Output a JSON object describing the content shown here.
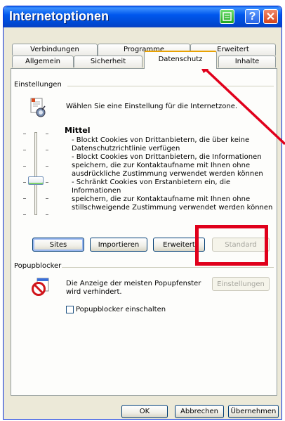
{
  "window": {
    "title": "Internetoptionen"
  },
  "tabs_back": [
    "Verbindungen",
    "Programme",
    "Erweitert"
  ],
  "tabs_front": [
    "Allgemein",
    "Sicherheit",
    "Datenschutz",
    "Inhalte"
  ],
  "active_tab": "Datenschutz",
  "settings": {
    "group_label": "Einstellungen",
    "intro": "Wählen Sie eine Einstellung für die Internetzone.",
    "level_title": "Mittel",
    "description": [
      "- Blockt Cookies von Drittanbietern, die über keine",
      "Datenschutzrichtlinie verfügen",
      "- Blockt Cookies von Drittanbietern, die Informationen",
      "speichern, die zur Kontaktaufname mit Ihnen ohne",
      "ausdrückliche Zustimmung verwendet werden können",
      "- Schränkt Cookies von Erstanbietern ein, die Informationen",
      "speichern, die zur Kontaktaufname mit Ihnen ohne",
      "stillschweigende Zustimmung verwendet werden können"
    ],
    "buttons": {
      "sites": "Sites",
      "import": "Importieren",
      "advanced": "Erweitert",
      "default": "Standard"
    },
    "slider_level": "Mittel"
  },
  "popup": {
    "group_label": "Popupblocker",
    "text_line1": "Die Anzeige der meisten Popupfenster",
    "text_line2": "wird verhindert.",
    "settings_button": "Einstellungen",
    "checkbox_label": "Popupblocker einschalten",
    "checkbox_checked": false
  },
  "footer": {
    "ok": "OK",
    "cancel": "Abbrechen",
    "apply": "Übernehmen"
  },
  "colors": {
    "titlebar": "#0058ee",
    "annotation": "#e0001b",
    "active_tab_accent": "#e8a202"
  }
}
